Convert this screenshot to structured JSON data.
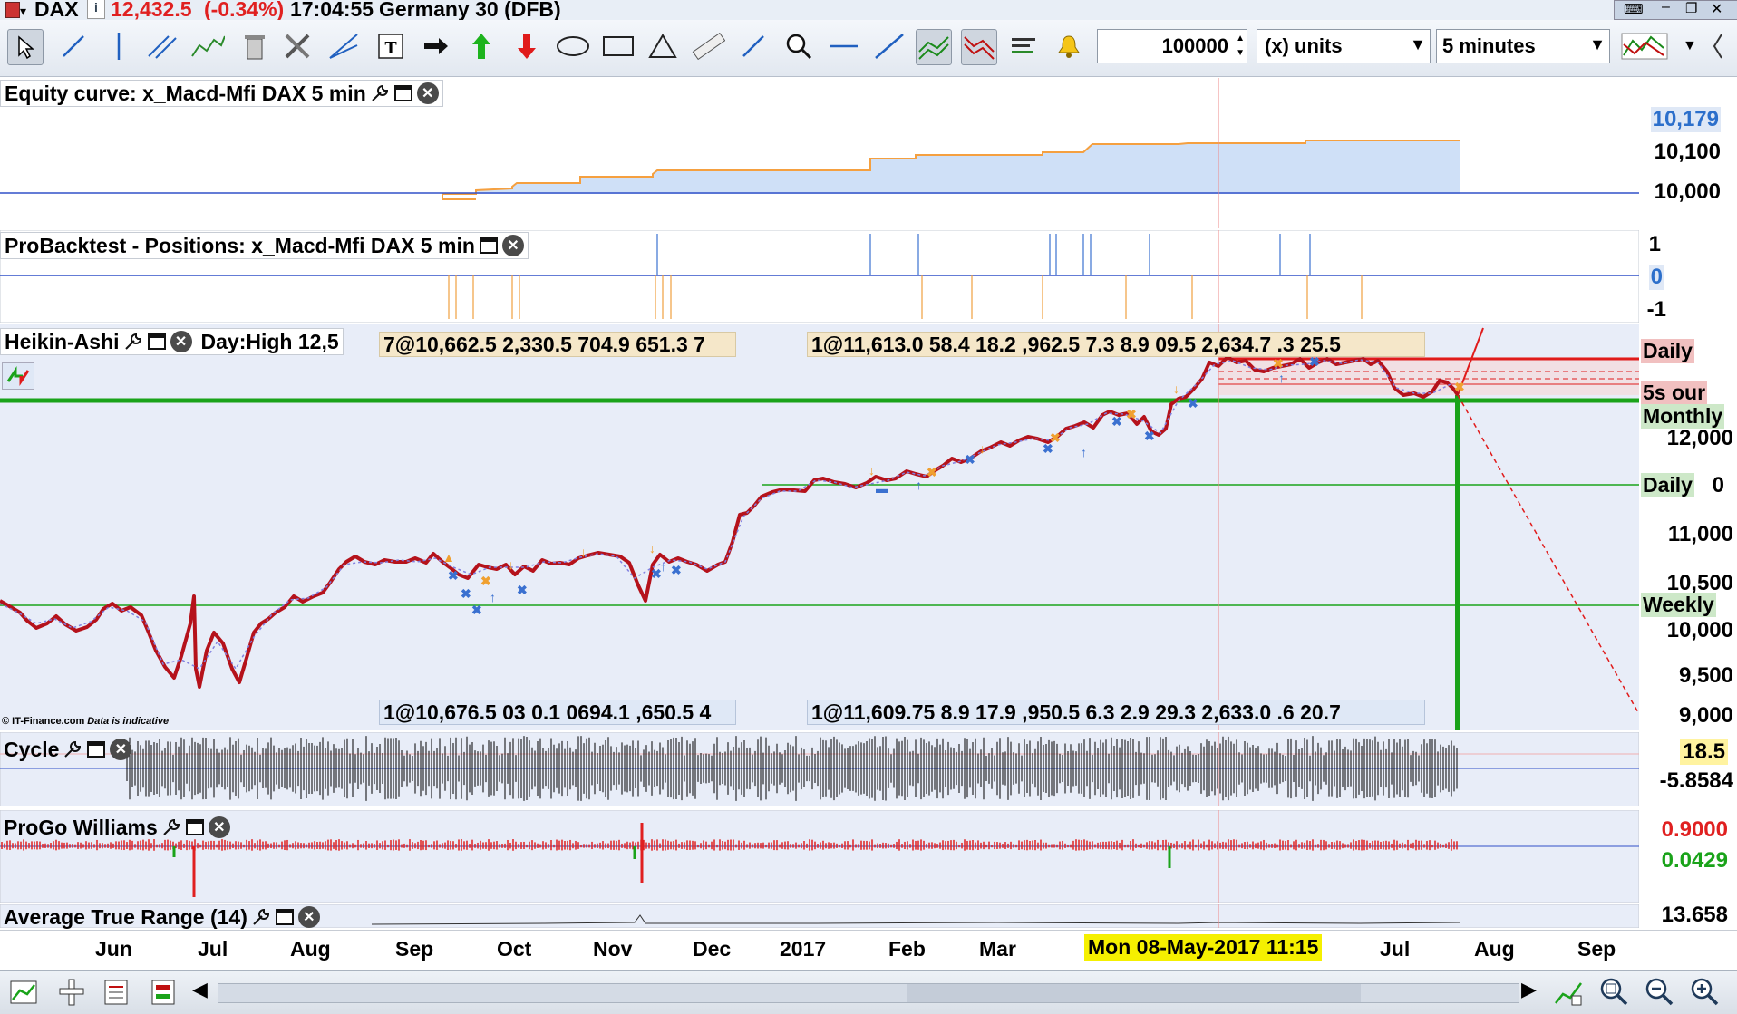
{
  "header": {
    "symbol": "DAX",
    "price": "12,432.5",
    "change": "(-0.34%)",
    "time": "17:04:55",
    "instrument": "Germany 30 (DFB)"
  },
  "toolbar": {
    "quantity": "100000",
    "units_label": "(x) units",
    "timeframe": "5 minutes"
  },
  "panels": {
    "equity": {
      "title": "Equity curve: x_Macd-Mfi DAX 5 min",
      "axis": [
        "10,179",
        "10,100",
        "10,000"
      ]
    },
    "positions": {
      "title": "ProBacktest - Positions: x_Macd-Mfi DAX 5 min",
      "axis": [
        "1",
        "0",
        "-1"
      ]
    },
    "price": {
      "title": "Heikin-Ashi",
      "day_high": "Day:High 12,5",
      "info_top_1": "7@10,662.5 2,330.5 704.9 651.3 7",
      "info_top_2": "1@11,613.0 58.4 18.2 ,962.5 7.3 8.9 09.5 2,634.7 .3 25.5",
      "info_bot_1": "1@10,676.5 03 0.1 0694.1 ,650.5 4",
      "info_bot_2": "1@11,609.75 8.9 17.9 ,950.5 6.3 2.9 29.3 2,633.0 .6 20.7",
      "axis": [
        "12,000",
        "11,000",
        "10,500",
        "10,000",
        "9,500",
        "9,000"
      ],
      "tag_daily_top": "Daily",
      "tag_hour": "5s our",
      "tag_monthly": "Monthly",
      "tag_daily_mid": "Daily",
      "tag_daily_mid_val": "0",
      "tag_weekly": "Weekly",
      "tag_high": "12,000",
      "copyright": "© IT-Finance.com",
      "disclaimer": "Data is indicative"
    },
    "cycle": {
      "title": "Cycle",
      "axis_1": "18.5",
      "axis_2": "-5.8584"
    },
    "williams": {
      "title": "ProGo Williams",
      "axis_1": "0.9000",
      "axis_2": "0.0429"
    },
    "atr": {
      "title": "Average True Range (14)",
      "axis": "13.658"
    }
  },
  "time_axis": {
    "labels": [
      "Jun",
      "Jul",
      "Aug",
      "Sep",
      "Oct",
      "Nov",
      "Dec",
      "2017",
      "Feb",
      "Mar",
      "Jul",
      "Aug",
      "Sep"
    ],
    "crosshair_label": "Mon 08-May-2017 11:15"
  },
  "colors": {
    "price_line": "#b5121b",
    "equity_line": "#f5a040",
    "equity_fill": "#cfe0f7",
    "support_green": "#1aa31a",
    "resistance_red": "#e01b1b",
    "cycle_black": "#000000",
    "williams_red": "#e02020"
  }
}
